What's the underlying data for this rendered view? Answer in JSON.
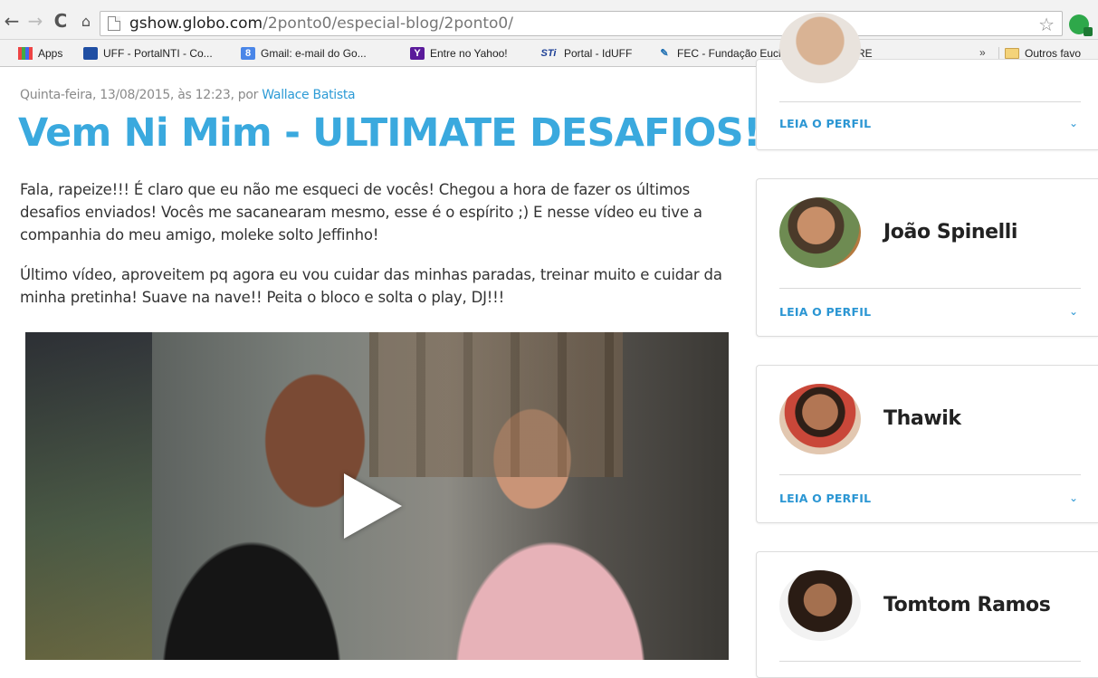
{
  "browser": {
    "url_host": "gshow.globo.com",
    "url_path": "/2ponto0/especial-blog/2ponto0/",
    "bookmarks": [
      {
        "label": "Apps"
      },
      {
        "label": "UFF - PortalNTI - Co..."
      },
      {
        "label": "Gmail: e-mail do Go..."
      },
      {
        "label": "Entre no Yahoo!"
      },
      {
        "label": "Portal - IdUFF"
      },
      {
        "label": "FEC - Fundação Eucl..."
      },
      {
        "label": "SPRE"
      }
    ],
    "bookmarks_more": "»",
    "other_bookmarks": "Outros favo",
    "icons": {
      "back": "back-arrow-icon",
      "forward": "forward-arrow-icon",
      "reload": "reload-icon",
      "home": "home-icon",
      "star": "star-icon",
      "extension": "extension-icon"
    },
    "bookmark_icon_texts": {
      "gmail": "8",
      "yahoo": "Y",
      "sti": "STi"
    }
  },
  "post": {
    "date_text": "Quinta-feira, 13/08/2015, às 12:23, por ",
    "author": "Wallace Batista",
    "title": "Vem Ni Mim - ULTIMATE DESAFIOS!",
    "paragraph1": "Fala, rapeize!!! É claro que eu não me esqueci de vocês! Chegou a hora de fazer os últimos desafios enviados! Vocês me sacanearam mesmo, esse é o espírito ;)  E nesse vídeo eu tive a companhia do meu amigo, moleke solto Jeffinho!",
    "paragraph2": "Último vídeo, aproveitem pq agora eu vou cuidar das minhas paradas, treinar muito e cuidar da minha pretinha! Suave na nave!! Peita o bloco e solta o play, DJ!!!"
  },
  "sidebar": {
    "leia_label": "LEIA O PERFIL",
    "chevron": "⌄",
    "profiles": [
      {
        "name": ""
      },
      {
        "name": "João Spinelli"
      },
      {
        "name": "Thawik"
      },
      {
        "name": "Tomtom Ramos"
      }
    ]
  },
  "colors": {
    "accent": "#3aa9de",
    "link": "#2b96d3"
  }
}
